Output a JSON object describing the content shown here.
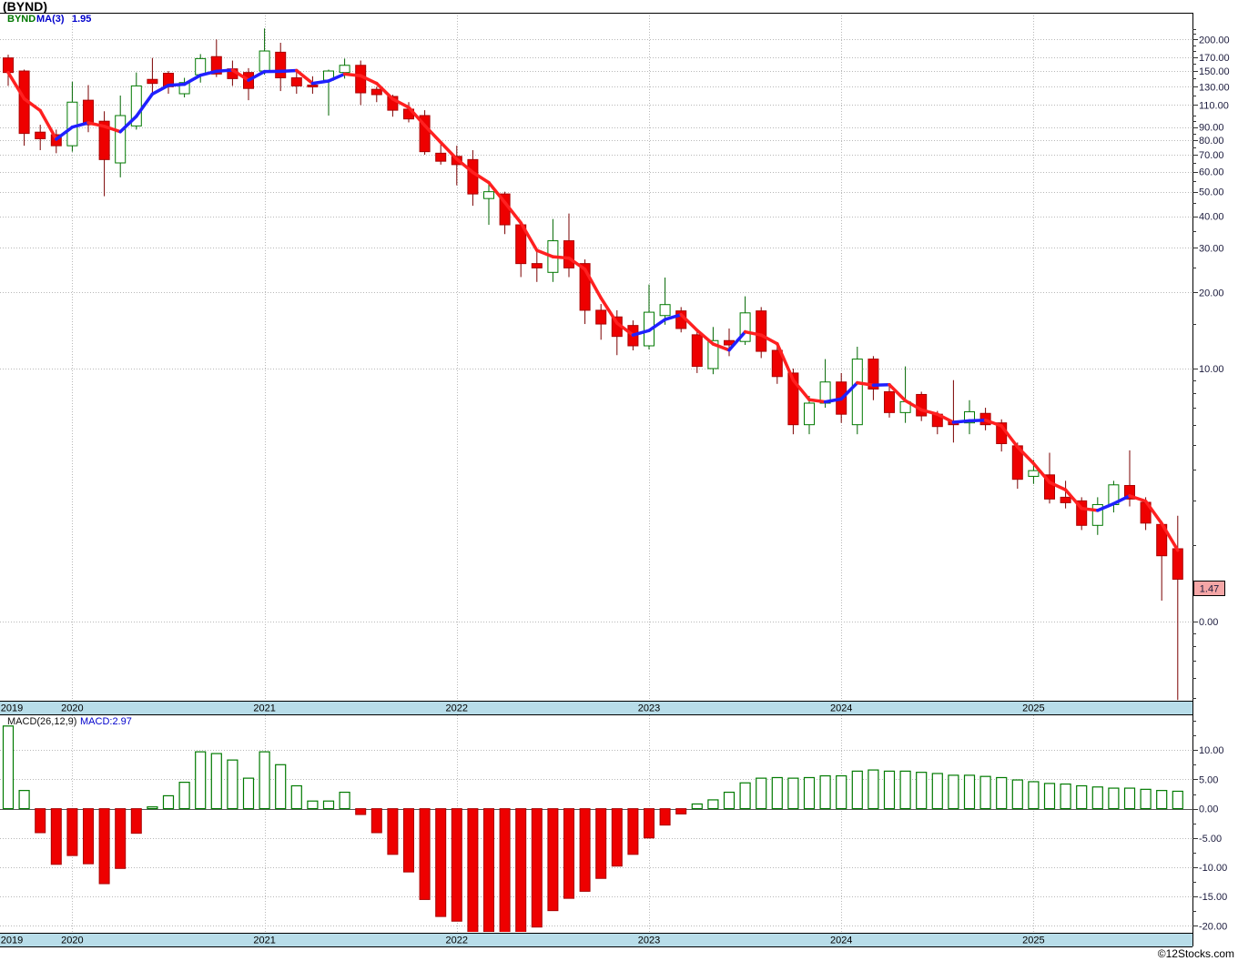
{
  "header": {
    "title": "(BYND)"
  },
  "price_chart": {
    "legend": {
      "symbol": "BYND",
      "ma_label": "MA(3)",
      "ma_value": "1.95"
    },
    "last_price_flag": "1.47"
  },
  "macd_panel": {
    "label": "MACD(26,12,9)",
    "value": "MACD:2.97"
  },
  "footer": {
    "credit": "©12Stocks.com"
  },
  "timeline": {
    "years": [
      {
        "label": "2019",
        "month_index": 0
      },
      {
        "label": "2020",
        "month_index": 4
      },
      {
        "label": "2021",
        "month_index": 16
      },
      {
        "label": "2022",
        "month_index": 28
      },
      {
        "label": "2023",
        "month_index": 40
      },
      {
        "label": "2024",
        "month_index": 52
      },
      {
        "label": "2025",
        "month_index": 64
      }
    ]
  },
  "colors": {
    "up_stroke": "#007a00",
    "up_fill": "#ffffff",
    "up_wick": "#006600",
    "down_fill": "#ee0000",
    "down_stroke": "#aa0000",
    "down_wick": "#7a0000",
    "ma_up": "#2020ff",
    "ma_down": "#ff2020",
    "grid": "#b8b8b8",
    "frame": "#000000",
    "band_bg": "#b8dde9",
    "band_text": "#000000",
    "axis_text": "#1a1a3c",
    "flag_bg": "#f5a6a6",
    "flag_border": "#000000"
  },
  "chart_data": [
    {
      "type": "candlestick",
      "title": "BYND monthly candlesticks with MA(3) overlay",
      "x": [
        "2019-09",
        "2019-10",
        "2019-11",
        "2019-12",
        "2020-01",
        "2020-02",
        "2020-03",
        "2020-04",
        "2020-05",
        "2020-06",
        "2020-07",
        "2020-08",
        "2020-09",
        "2020-10",
        "2020-11",
        "2020-12",
        "2021-01",
        "2021-02",
        "2021-03",
        "2021-04",
        "2021-05",
        "2021-06",
        "2021-07",
        "2021-08",
        "2021-09",
        "2021-10",
        "2021-11",
        "2021-12",
        "2022-01",
        "2022-02",
        "2022-03",
        "2022-04",
        "2022-05",
        "2022-06",
        "2022-07",
        "2022-08",
        "2022-09",
        "2022-10",
        "2022-11",
        "2022-12",
        "2023-01",
        "2023-02",
        "2023-03",
        "2023-04",
        "2023-05",
        "2023-06",
        "2023-07",
        "2023-08",
        "2023-09",
        "2023-10",
        "2023-11",
        "2023-12",
        "2024-01",
        "2024-02",
        "2024-03",
        "2024-04",
        "2024-05",
        "2024-06",
        "2024-07",
        "2024-08",
        "2024-09",
        "2024-10",
        "2024-11",
        "2024-12",
        "2025-01",
        "2025-02",
        "2025-03",
        "2025-04",
        "2025-05",
        "2025-06",
        "2025-07",
        "2025-08",
        "2025-09",
        "2025-10"
      ],
      "y_axis": {
        "scale": "log",
        "labels": [
          {
            "text": "200.00",
            "value": 200
          },
          {
            "text": "170.00",
            "value": 170
          },
          {
            "text": "150.00",
            "value": 150
          },
          {
            "text": "130.00",
            "value": 130
          },
          {
            "text": "110.00",
            "value": 110
          },
          {
            "text": "90.00",
            "value": 90
          },
          {
            "text": "80.00",
            "value": 80
          },
          {
            "text": "70.00",
            "value": 70
          },
          {
            "text": "60.00",
            "value": 60
          },
          {
            "text": "50.00",
            "value": 50
          },
          {
            "text": "40.00",
            "value": 40
          },
          {
            "text": "30.00",
            "value": 30
          },
          {
            "text": "20.00",
            "value": 20
          },
          {
            "text": "10.00",
            "value": 10
          },
          {
            "text": "0.00",
            "value": 1
          }
        ]
      },
      "series": [
        {
          "name": "BYND",
          "ohlc": [
            [
              169,
              174,
              131,
              148
            ],
            [
              150,
              152,
              76,
              85
            ],
            [
              86,
              92,
              73,
              81
            ],
            [
              84,
              88,
              71,
              76
            ],
            [
              76,
              136,
              72,
              113
            ],
            [
              115,
              132,
              86,
              92
            ],
            [
              95,
              104,
              48,
              67
            ],
            [
              65,
              120,
              57,
              100
            ],
            [
              91,
              148,
              88,
              131
            ],
            [
              139,
              169,
              120,
              134
            ],
            [
              147,
              150,
              122,
              130
            ],
            [
              122,
              141,
              118,
              135
            ],
            [
              145,
              175,
              135,
              168
            ],
            [
              171,
              200,
              142,
              146
            ],
            [
              153,
              165,
              131,
              140
            ],
            [
              148,
              154,
              115,
              128
            ],
            [
              150,
              221,
              145,
              180
            ],
            [
              178,
              194,
              125,
              141
            ],
            [
              141,
              150,
              122,
              131
            ],
            [
              132,
              143,
              122,
              130
            ],
            [
              138,
              152,
              100,
              150
            ],
            [
              148,
              168,
              140,
              158
            ],
            [
              158,
              165,
              110,
              123
            ],
            [
              127,
              130,
              113,
              121
            ],
            [
              119,
              121,
              99,
              105
            ],
            [
              106,
              113,
              94,
              97
            ],
            [
              100,
              105,
              70,
              72
            ],
            [
              71,
              77,
              64,
              66
            ],
            [
              69,
              76,
              53,
              64
            ],
            [
              67,
              73,
              44,
              49
            ],
            [
              47,
              55,
              37,
              50
            ],
            [
              49,
              50,
              34,
              37
            ],
            [
              37,
              38,
              23,
              26
            ],
            [
              26,
              29,
              22,
              25
            ],
            [
              24,
              39,
              22,
              32
            ],
            [
              32,
              41,
              23,
              25
            ],
            [
              26,
              27,
              15,
              17
            ],
            [
              17,
              18,
              13,
              15
            ],
            [
              16,
              17,
              11.3,
              13.4
            ],
            [
              14.8,
              15.5,
              11.8,
              12.3
            ],
            [
              12.3,
              21.5,
              11.9,
              16.7
            ],
            [
              16.2,
              22.9,
              14.9,
              17.9
            ],
            [
              16.9,
              17.5,
              13.9,
              14.4
            ],
            [
              13.6,
              14,
              9.6,
              10.2
            ],
            [
              10,
              14.6,
              9.5,
              12.9
            ],
            [
              12.9,
              14.4,
              11.2,
              12.4
            ],
            [
              12.8,
              19.3,
              12.4,
              16.6
            ],
            [
              16.9,
              17.5,
              11,
              11.7
            ],
            [
              11.8,
              12.5,
              8.7,
              9.3
            ],
            [
              9.6,
              10,
              5.5,
              6
            ],
            [
              6,
              7.8,
              5.5,
              7.3
            ],
            [
              7.3,
              10.9,
              7,
              8.85
            ],
            [
              8.85,
              9.6,
              6.1,
              6.6
            ],
            [
              6,
              12.2,
              5.5,
              10.9
            ],
            [
              10.9,
              11.2,
              7.5,
              8.3
            ],
            [
              8.1,
              8.6,
              6.4,
              6.7
            ],
            [
              6.7,
              10.2,
              6.1,
              7.4
            ],
            [
              7.9,
              8.1,
              6.2,
              6.5
            ],
            [
              6.6,
              6.8,
              5.5,
              5.9
            ],
            [
              6.2,
              9,
              5.1,
              6
            ],
            [
              6.1,
              7.5,
              5.5,
              6.75
            ],
            [
              6.65,
              7,
              5.7,
              6
            ],
            [
              6.1,
              6.3,
              4.7,
              5.05
            ],
            [
              4.95,
              5.1,
              3.35,
              3.65
            ],
            [
              3.75,
              4.35,
              3.5,
              3.95
            ],
            [
              3.8,
              4.65,
              2.93,
              3.05
            ],
            [
              3.1,
              3.6,
              2.8,
              2.95
            ],
            [
              3,
              3.1,
              2.3,
              2.4
            ],
            [
              2.4,
              3.1,
              2.2,
              2.9
            ],
            [
              2.9,
              3.6,
              2.7,
              3.47
            ],
            [
              3.45,
              4.75,
              2.85,
              3.05
            ],
            [
              2.96,
              3.1,
              2.3,
              2.45
            ],
            [
              2.42,
              2.5,
              1.21,
              1.82
            ],
            [
              1.94,
              2.62,
              0.49,
              1.47
            ]
          ]
        },
        {
          "name": "MA(3)",
          "note": "3-month simple moving average of close; drawn blue when rising, red when falling",
          "last_value": 1.95
        }
      ],
      "last_close": 1.47
    },
    {
      "type": "bar",
      "title": "MACD(26,12,9) histogram",
      "x_note": "same months as chart 0",
      "values": [
        14.1,
        3.1,
        -4.1,
        -9.5,
        -8,
        -9.4,
        -12.8,
        -10.2,
        -4.2,
        0.3,
        2.2,
        4.5,
        9.7,
        9.4,
        8.3,
        5.2,
        9.7,
        7.5,
        3.9,
        1.3,
        1.3,
        2.8,
        -1,
        -4.1,
        -7.8,
        -10.8,
        -15.5,
        -18.4,
        -19.2,
        -21.1,
        -21,
        -21.1,
        -21.2,
        -20.2,
        -17.4,
        -15.3,
        -14.1,
        -11.9,
        -9.8,
        -7.8,
        -5,
        -2.8,
        -0.9,
        0.8,
        1.5,
        2.8,
        4.4,
        5.2,
        5.3,
        5.2,
        5.3,
        5.6,
        5.6,
        6.4,
        6.6,
        6.4,
        6.4,
        6.2,
        6,
        5.7,
        5.7,
        5.5,
        5.3,
        4.9,
        4.6,
        4.3,
        4.2,
        3.9,
        3.7,
        3.5,
        3.5,
        3.3,
        3.1,
        2.97
      ],
      "y_axis": {
        "scale": "linear",
        "labels": [
          {
            "text": "10.00",
            "value": 10
          },
          {
            "text": "5.00",
            "value": 5
          },
          {
            "text": "0.00",
            "value": 0
          },
          {
            "text": "-5.00",
            "value": -5
          },
          {
            "text": "-10.00",
            "value": -10
          },
          {
            "text": "-15.00",
            "value": -15
          },
          {
            "text": "-20.00",
            "value": -20
          }
        ]
      },
      "positive_style": "hollow green",
      "negative_style": "solid red",
      "last_value": 2.97
    }
  ]
}
